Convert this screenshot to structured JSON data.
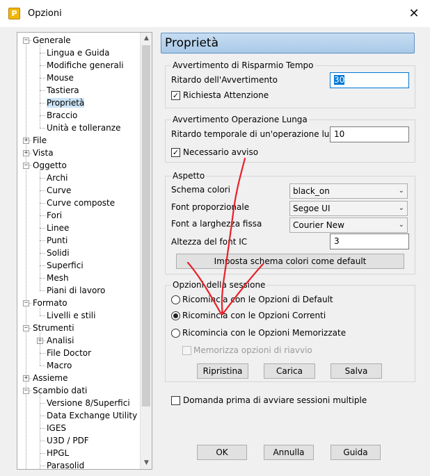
{
  "window": {
    "title": "Opzioni",
    "close_symbol": "✕",
    "app_icon_glyph": "P"
  },
  "tree": {
    "rows": [
      {
        "label": "Generale",
        "level": 0,
        "expander": "−"
      },
      {
        "label": "Lingua e Guida",
        "level": 1
      },
      {
        "label": "Modifiche generali",
        "level": 1
      },
      {
        "label": "Mouse",
        "level": 1
      },
      {
        "label": "Tastiera",
        "level": 1
      },
      {
        "label": "Proprietà",
        "level": 1,
        "selected": true
      },
      {
        "label": "Braccio",
        "level": 1
      },
      {
        "label": "Unità e tolleranze",
        "level": 1
      },
      {
        "label": "File",
        "level": 0,
        "expander": "+"
      },
      {
        "label": "Vista",
        "level": 0,
        "expander": "+"
      },
      {
        "label": "Oggetto",
        "level": 0,
        "expander": "−"
      },
      {
        "label": "Archi",
        "level": 1
      },
      {
        "label": "Curve",
        "level": 1
      },
      {
        "label": "Curve composte",
        "level": 1
      },
      {
        "label": "Fori",
        "level": 1
      },
      {
        "label": "Linee",
        "level": 1
      },
      {
        "label": "Punti",
        "level": 1
      },
      {
        "label": "Solidi",
        "level": 1
      },
      {
        "label": "Superfici",
        "level": 1
      },
      {
        "label": "Mesh",
        "level": 1
      },
      {
        "label": "Piani di lavoro",
        "level": 1
      },
      {
        "label": "Formato",
        "level": 0,
        "expander": "−"
      },
      {
        "label": "Livelli e stili",
        "level": 1
      },
      {
        "label": "Strumenti",
        "level": 0,
        "expander": "−"
      },
      {
        "label": "Analisi",
        "level": 1,
        "expander": "+"
      },
      {
        "label": "File Doctor",
        "level": 1
      },
      {
        "label": "Macro",
        "level": 1
      },
      {
        "label": "Assieme",
        "level": 0,
        "expander": "+"
      },
      {
        "label": "Scambio dati",
        "level": 0,
        "expander": "−"
      },
      {
        "label": "Versione 8/Superfici",
        "level": 1
      },
      {
        "label": "Data Exchange Utility",
        "level": 1
      },
      {
        "label": "IGES",
        "level": 1
      },
      {
        "label": "U3D / PDF",
        "level": 1
      },
      {
        "label": "HPGL",
        "level": 1
      },
      {
        "label": "Parasolid",
        "level": 1
      }
    ]
  },
  "panel": {
    "header": "Proprietà",
    "timesaving": {
      "title": "Avvertimento di Risparmio Tempo",
      "delay_label": "Ritardo dell'Avvertimento",
      "delay_value": "30",
      "attention_label": "Richiesta Attenzione",
      "attention_checked": "✓"
    },
    "longop": {
      "title": "Avvertimento Operazione  Lunga",
      "delay_label": "Ritardo temporale di un'operazione lunga",
      "delay_value": "10",
      "notify_label": "Necessario avviso",
      "notify_checked": "✓"
    },
    "aspect": {
      "title": "Aspetto",
      "color_scheme_label": "Schema colori",
      "color_scheme_value": "black_on",
      "prop_font_label": "Font proporzionale",
      "prop_font_value": "Segoe UI",
      "fixed_font_label": "Font a larghezza fissa",
      "fixed_font_value": "Courier New",
      "ic_height_label": "Altezza del font IC",
      "ic_height_value": "3",
      "set_default_button": "Imposta schema colori come default"
    },
    "session": {
      "title": "Opzioni della sessione",
      "radio_default": "Ricomincia con le Opzioni di Default",
      "radio_current": "Ricomincia con le Opzioni Correnti",
      "radio_saved": "Ricomincia con le Opzioni Memorizzate",
      "store_restart_label": "Memorizza opzioni di riavvio",
      "restore_button": "Ripristina",
      "load_button": "Carica",
      "save_button": "Salva"
    },
    "multi_session_label": "Domanda prima di avviare sessioni multiple"
  },
  "footer": {
    "ok": "OK",
    "cancel": "Annulla",
    "help": "Guida"
  },
  "colors": {
    "accent": "#0078d7",
    "annotation": "#e8202a",
    "header_border": "#5f8fbf"
  }
}
